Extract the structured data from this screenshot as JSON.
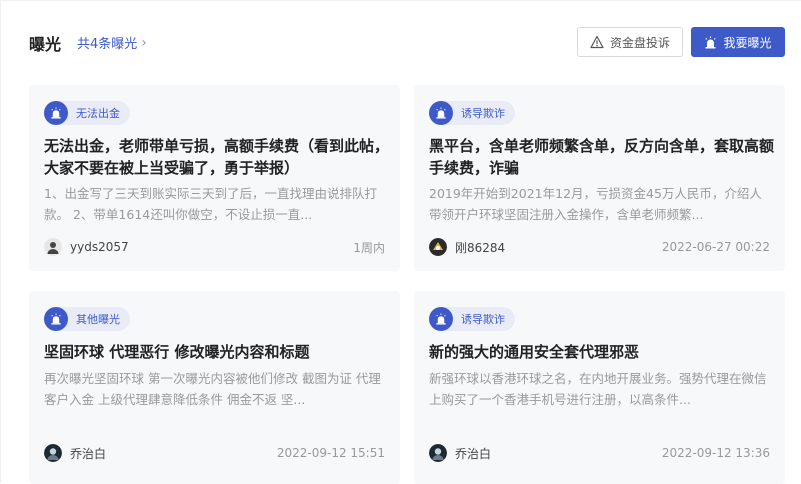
{
  "header": {
    "title": "曝光",
    "count_link": "共4条曝光",
    "complain_button": "资金盘投诉",
    "expose_button": "我要曝光"
  },
  "colors": {
    "accent": "#3d5ac8",
    "tag_bg": "#e9ecf7",
    "card_bg": "#f7f8fa"
  },
  "cards": [
    {
      "tag": "无法出金",
      "title": "无法出金，老师带单亏损，高额手续费（看到此帖，大家不要在被上当受骗了，勇于举报）",
      "desc": "1、出金写了三天到账实际三天到了后，一直找理由说排队打款。 2、带单1614还叫你做空，不设止损一直...",
      "author": "yyds2057",
      "time": "1周内"
    },
    {
      "tag": "诱导欺诈",
      "title": "黑平台，含单老师频繁含单，反方向含单，套取高额手续费，诈骗",
      "desc": "2019年开始到2021年12月，亏损资金45万人民币，介绍人带领开户环球坚固注册入金操作，含单老师频繁...",
      "author": "刚86284",
      "time": "2022-06-27 00:22"
    },
    {
      "tag": "其他曝光",
      "title": "坚固环球 代理恶行  修改曝光内容和标题",
      "desc": "再次曝光坚固环球 第一次曝光内容被他们修改 截图为证 代理客户入金 上级代理肆意降低条件 佣金不返 坚...",
      "author": "乔治白",
      "time": "2022-09-12 15:51"
    },
    {
      "tag": "诱导欺诈",
      "title": "新的强大的通用安全套代理邪恶",
      "desc": "新强环球以香港环球之名，在内地开展业务。强势代理在微信上购买了一个香港手机号进行注册，以高条件...",
      "author": "乔治白",
      "time": "2022-09-12 13:36"
    }
  ]
}
